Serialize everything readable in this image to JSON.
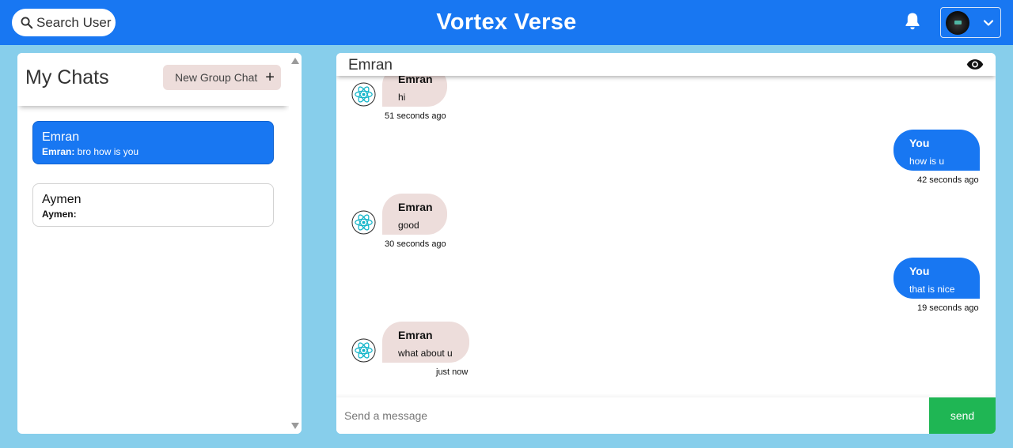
{
  "header": {
    "search_label": "Search User",
    "app_title": "Vortex Verse"
  },
  "sidebar": {
    "title": "My Chats",
    "new_group_label": "New Group Chat",
    "chats": [
      {
        "name": "Emran",
        "preview_sender": "Emran:",
        "preview_text": " bro how is you",
        "active": true
      },
      {
        "name": "Aymen",
        "preview_sender": "Aymen:",
        "preview_text": "",
        "active": false
      }
    ]
  },
  "conversation": {
    "partner_name": "Emran",
    "messages": [
      {
        "direction": "in",
        "sender": "Emran",
        "text": "hi",
        "time": "51 seconds ago"
      },
      {
        "direction": "out",
        "sender": "You",
        "text": "how is u",
        "time": "42 seconds ago"
      },
      {
        "direction": "in",
        "sender": "Emran",
        "text": "good",
        "time": "30 seconds ago"
      },
      {
        "direction": "out",
        "sender": "You",
        "text": "that is nice",
        "time": "19 seconds ago"
      },
      {
        "direction": "in",
        "sender": "Emran",
        "text": "what about u",
        "time": "just now"
      }
    ],
    "input_placeholder": "Send a message",
    "input_value": "",
    "send_label": "send"
  },
  "colors": {
    "primary": "#1877f2",
    "background": "#87ceeb",
    "incoming_bubble": "#eddddb",
    "send_button": "#1fb654"
  },
  "icons": {
    "search": "search-icon",
    "bell": "bell-icon",
    "chevron": "chevron-down-icon",
    "plus": "plus-icon",
    "eye": "eye-icon",
    "message_avatar": "react-logo-icon"
  }
}
